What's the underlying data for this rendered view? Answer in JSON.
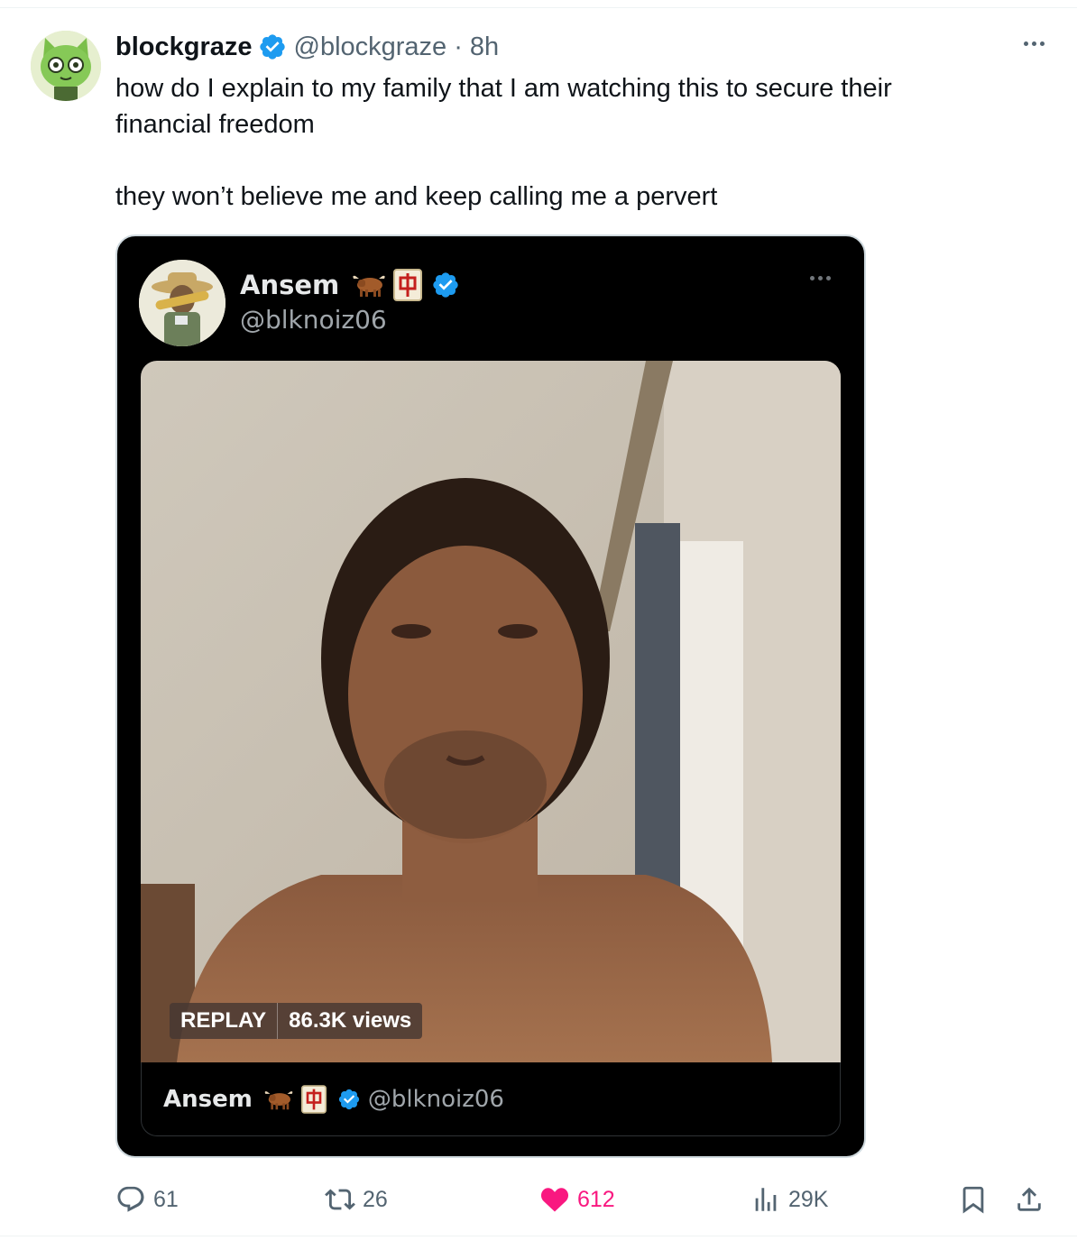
{
  "tweet": {
    "author_name": "blockgraze",
    "author_handle": "@blockgraze",
    "separator": "·",
    "time": "8h",
    "text_line1": "how do I explain to my family that I am watching this to secure their",
    "text_line2": "financial freedom",
    "text_line3": "they won’t believe me and keep calling me a pervert"
  },
  "quoted": {
    "author_name": "Ansem",
    "author_handle": "@blknoiz06",
    "name_emojis": [
      "ox-icon",
      "mahjong-red-dragon-icon"
    ],
    "video": {
      "replay_label": "REPLAY",
      "views_label": "86.3K views"
    },
    "footer_name": "Ansem",
    "footer_handle": "@blknoiz06"
  },
  "actions": {
    "replies": "61",
    "reposts": "26",
    "likes": "612",
    "views": "29K"
  },
  "colors": {
    "verified_blue": "#1d9bf0",
    "like_pink": "#f91880",
    "muted_text": "#536471"
  }
}
